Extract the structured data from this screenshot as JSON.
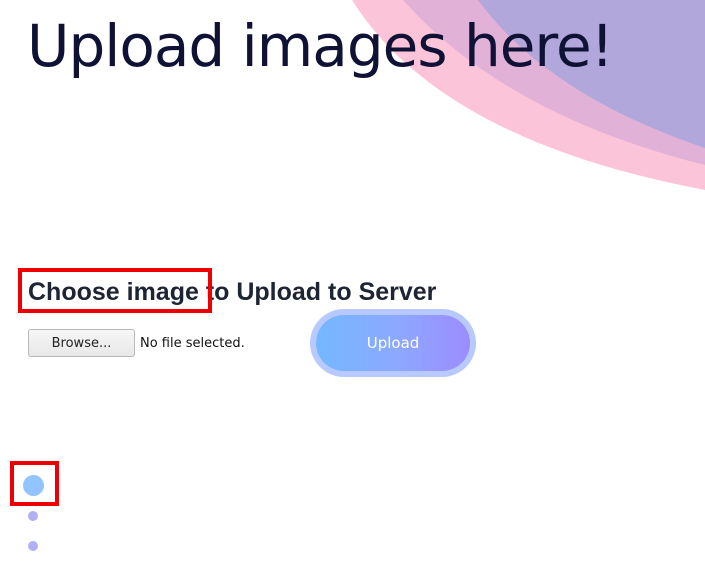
{
  "header": {
    "title": "Upload images here!"
  },
  "upload_form": {
    "heading": "Choose image to Upload to Server",
    "browse_label": "Browse...",
    "file_status": "No file selected.",
    "upload_label": "Upload"
  },
  "carousel": {
    "dot_count": 3,
    "active_index": 0
  },
  "colors": {
    "title_text": "#0f1235",
    "wave_pink": "#fcc4d8",
    "wave_mauve": "#e1b1d8",
    "wave_purple": "#b1a7db",
    "upload_gradient_start": "#74b8ff",
    "upload_gradient_end": "#9c8cff",
    "highlight_border": "#ee0000",
    "dot_active": "#92c5ff",
    "dot_inactive": "#b1b0f6"
  }
}
